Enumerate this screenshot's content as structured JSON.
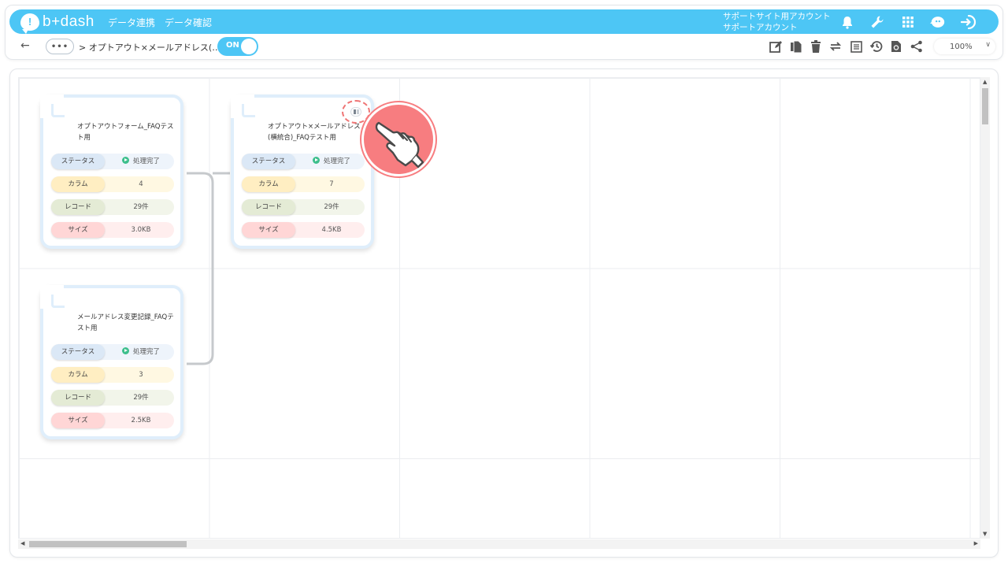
{
  "header": {
    "logo_mark": "!",
    "logo_text": "b+dash",
    "nav": [
      "データ連携",
      "データ確認"
    ],
    "account_line1": "サポートサイト用アカウント",
    "account_line2": "サポートアカウント",
    "icons": [
      "bell-icon",
      "wrench-icon",
      "grid-icon",
      "avatar-icon",
      "logout-icon"
    ]
  },
  "toolbar": {
    "back": "←",
    "more": "•••",
    "breadcrumb": "> オプトアウト×メールアドレス(…",
    "toggle_label": "ON",
    "zoom": "100%",
    "zoom_chevron": "∨",
    "tools": [
      "edit-icon",
      "copy-icon",
      "delete-icon",
      "swap-icon",
      "list-icon",
      "history-icon",
      "refresh-icon",
      "share-icon"
    ]
  },
  "labels": {
    "status": "ステータス",
    "column": "カラム",
    "record": "レコード",
    "size": "サイズ"
  },
  "nodes": [
    {
      "title": "オプトアウトフォーム_FAQテスト用",
      "status": "処理完了",
      "columns": "4",
      "records": "29件",
      "size": "3.0KB"
    },
    {
      "title": "オプトアウト×メールアドレス(横統合)_FAQテスト用",
      "status": "処理完了",
      "columns": "7",
      "records": "29件",
      "size": "4.5KB"
    },
    {
      "title": "メールアドレス変更記録_FAQテスト用",
      "status": "処理完了",
      "columns": "3",
      "records": "29件",
      "size": "2.5KB"
    }
  ],
  "colors": {
    "brand": "#4dc6f5",
    "status_ok": "#3dbf8c",
    "highlight": "#f77d80"
  }
}
